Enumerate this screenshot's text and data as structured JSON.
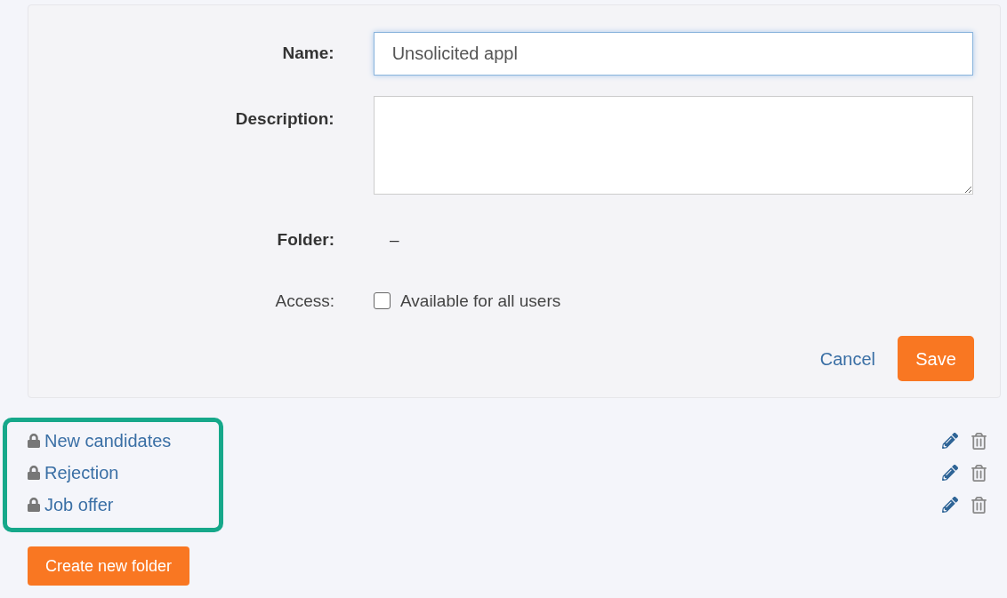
{
  "form": {
    "name": {
      "label": "Name:",
      "value": "Unsolicited appl"
    },
    "description": {
      "label": "Description:"
    },
    "folder": {
      "label": "Folder:",
      "value": "–"
    },
    "access": {
      "label": "Access:",
      "option": "Available for all users",
      "checked": false
    },
    "buttons": {
      "cancel": "Cancel",
      "save": "Save"
    }
  },
  "folders": [
    {
      "name": "New candidates",
      "locked": true
    },
    {
      "name": "Rejection",
      "locked": true
    },
    {
      "name": "Job offer",
      "locked": true
    }
  ],
  "create_button": "Create new folder"
}
